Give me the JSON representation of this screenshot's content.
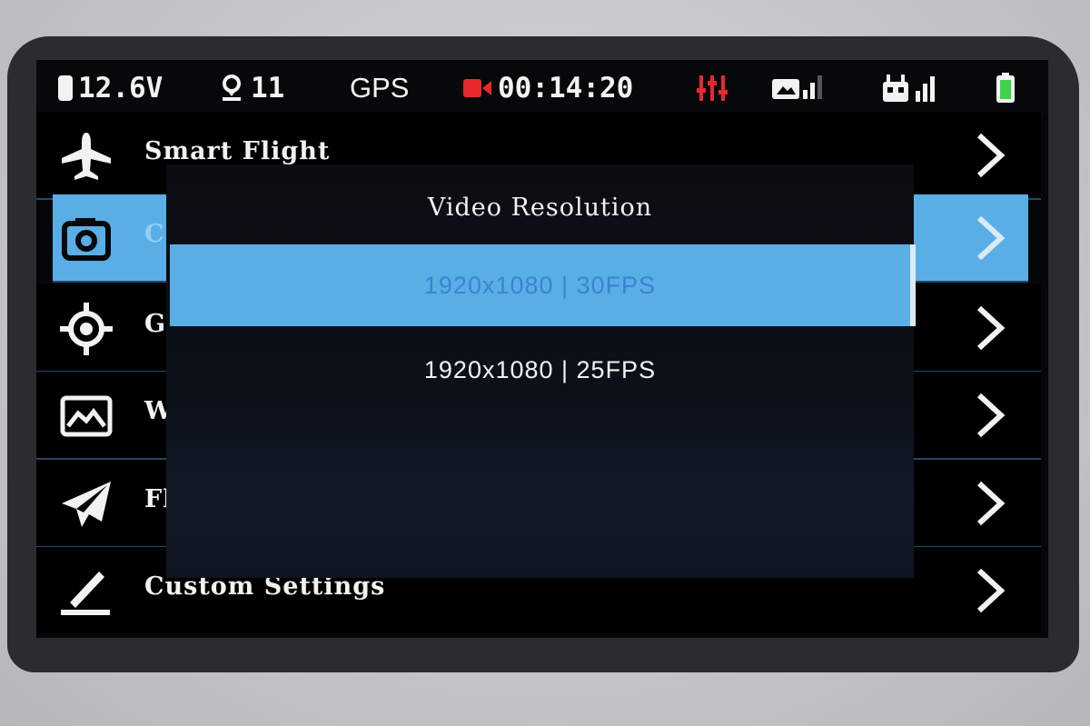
{
  "status_bar": {
    "voltage": "12.6V",
    "satellites": "11",
    "gps_label": "GPS",
    "record_time": "00:14:20"
  },
  "menu": {
    "items": [
      {
        "label": "Smart Flight",
        "icon": "airplane-icon"
      },
      {
        "label": "Ca",
        "icon": "camera-icon"
      },
      {
        "label": "GF",
        "icon": "gps-target-icon"
      },
      {
        "label": "W:",
        "icon": "image-icon"
      },
      {
        "label": "Fl",
        "icon": "paper-plane-icon"
      },
      {
        "label": "Custom Settings",
        "icon": "pencil-icon"
      }
    ]
  },
  "dialog": {
    "title": "Video Resolution",
    "options": [
      {
        "label": "1920x1080 | 30FPS",
        "selected": true
      },
      {
        "label": "1920x1080 | 25FPS",
        "selected": false
      }
    ]
  },
  "colors": {
    "highlight": "#5aaee6",
    "record_red": "#e8282a",
    "battery_green": "#3fd24a"
  }
}
